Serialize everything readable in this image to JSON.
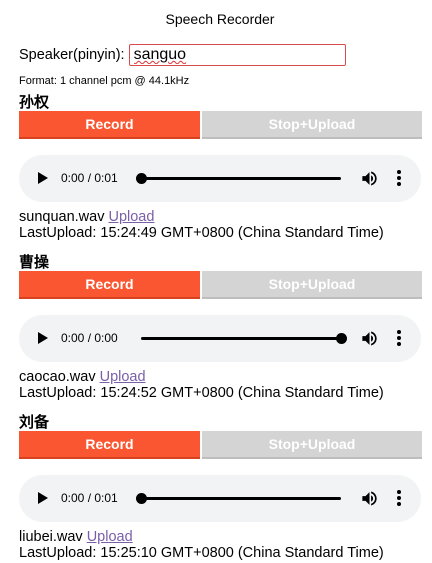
{
  "app": {
    "title": "Speech Recorder"
  },
  "speaker": {
    "label": "Speaker(pinyin):",
    "value": "sanguo"
  },
  "format": {
    "text": "Format: 1 channel pcm @ 44.1kHz"
  },
  "buttons": {
    "record": "Record",
    "stop_upload": "Stop+Upload"
  },
  "colors": {
    "record": "#fa5631",
    "stop": "#d4d4d4",
    "player_bg": "#f1f3f4",
    "link": "#7a5fa8"
  },
  "sections": [
    {
      "name": "孙权",
      "player_time": "0:00 / 0:01",
      "progress": 0,
      "file": "sunquan.wav",
      "link": "Upload",
      "last_upload": "LastUpload: 15:24:49 GMT+0800 (China Standard Time)"
    },
    {
      "name": "曹操",
      "player_time": "0:00 / 0:00",
      "progress": 1,
      "file": "caocao.wav",
      "link": "Upload",
      "last_upload": "LastUpload: 15:24:52 GMT+0800 (China Standard Time)"
    },
    {
      "name": "刘备",
      "player_time": "0:00 / 0:01",
      "progress": 0,
      "file": "liubei.wav",
      "link": "Upload",
      "last_upload": "LastUpload: 15:25:10 GMT+0800 (China Standard Time)"
    }
  ]
}
